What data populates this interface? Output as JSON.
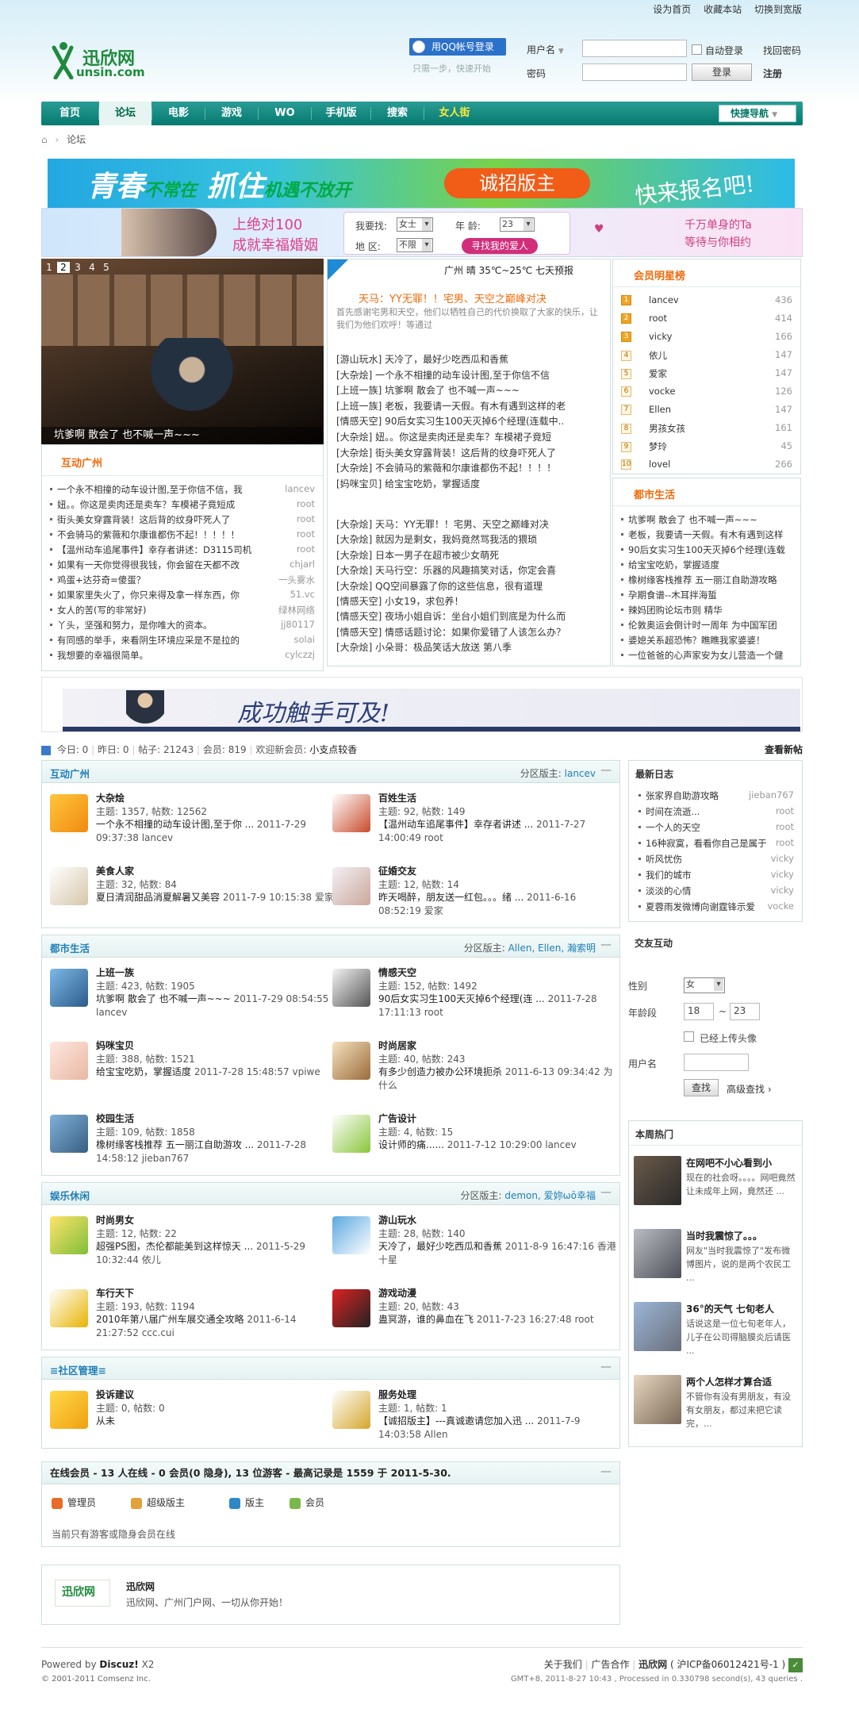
{
  "toplinks": [
    "设为首页",
    "收藏本站",
    "切换到宽版"
  ],
  "logo": {
    "cn": "迅欣网",
    "en": "unsin.com"
  },
  "login": {
    "qq_button": "用QQ帐号登录",
    "qq_sub": "只需一步，快速开始",
    "username_label": "用户名",
    "password_label": "密码",
    "autologin": "自动登录",
    "forgot": "找回密码",
    "login_btn": "登录",
    "register": "注册"
  },
  "nav": {
    "items": [
      "首页",
      "论坛",
      "电影",
      "游戏",
      "WO",
      "手机版",
      "搜索",
      "女人街"
    ],
    "quick": "快捷导航"
  },
  "breadcrumb": "论坛",
  "banner1": {
    "a": "青春",
    "b": "不常在",
    "c": "抓住",
    "d": "机遇不放开",
    "btn": "诚招版主",
    "tag": "快来报名吧!"
  },
  "banner2": {
    "l1": "上绝对100",
    "l2": "成就幸福婚姻",
    "find": "我要找:",
    "gender": "女士",
    "age_label": "年  龄:",
    "age": "23",
    "area": "地  区:",
    "area_val": "不限",
    "btn": "寻找我的爱人",
    "r1": "千万单身的Ta",
    "r2": "等待与你相约"
  },
  "slider": {
    "nums": [
      "1",
      "2",
      "3",
      "4",
      "5"
    ],
    "caption": "坑爹啊 散会了 也不喊一声~~~"
  },
  "weather": "广州  晴  35℃~25℃  七天预报",
  "headline": {
    "title": "天马：YY无罪！！宅男、天空之巅峰对决",
    "desc": "首先感谢宅男和天空，他们以牺牲自己的代价换取了大家的快乐，让我们为他们欢呼！等通过"
  },
  "news1": [
    "[游山玩水] 天冷了，最好少吃西瓜和香蕉",
    "[大杂烩] 一个永不相撞的动车设计图,至于你信不信",
    "[上班一族] 坑爹啊 散会了 也不喊一声~~~",
    "[上班一族] 老板，我要请一天假。有木有遇到这样的老",
    "[情感天空] 90后女实习生100天灭掉6个经理(连载中..",
    "[大杂烩] 妞。。你这是卖肉还是卖车？车模裙子竟短",
    "[大杂烩] 街头美女穿露背装！这后背的纹身吓死人了",
    "[大杂烩] 不会骑马的紫薇和尔康谁都伤不起！！！！",
    "[妈咪宝贝] 给宝宝吃奶，掌握适度"
  ],
  "news2": [
    "[大杂烩] 天马：YY无罪！！宅男、天空之巅峰对决",
    "[大杂烩] 就因为是剩女，我妈竟然骂我活的猥琐",
    "[大杂烩] 日本一男子在超市被少女萌死",
    "[大杂烩] 天马行空：乐器的风趣搞笑对话，你定会喜",
    "[大杂烩] QQ空间暴露了你的这些信息，很有道理",
    "[情感天空] 小女19，求包养！",
    "[情感天空] 夜场小姐自诉：坐台小姐们到底是为什么而",
    "[情感天空] 情感话题讨论：如果你爱错了人该怎么办？",
    "[大杂烩] 小朵哥：极品笑话大放送 第八季"
  ],
  "hudong": {
    "title": "互动广州",
    "items": [
      {
        "t": "一个永不相撞的动车设计图,至于你信不信，我",
        "a": "lancev"
      },
      {
        "t": "妞。。你这是卖肉还是卖车？车模裙子竟短成",
        "a": "root"
      },
      {
        "t": "街头美女穿露背装！这后背的纹身吓死人了",
        "a": "root"
      },
      {
        "t": "不会骑马的紫薇和尔康谁都伤不起！！！！！",
        "a": "root"
      },
      {
        "t": "【温州动车追尾事件】幸存者讲述：D3115司机",
        "a": "root"
      },
      {
        "t": "如果有一天你觉得很我钱，你会留在天都不改",
        "a": "chjarl"
      },
      {
        "t": "鸡蛋+达芬奇=傻蛋？",
        "a": "一头雾水"
      },
      {
        "t": "如果家里失火了，你只来得及拿一样东西，你",
        "a": "51.vc"
      },
      {
        "t": "女人的苦(写的非常好)",
        "a": "绿林网络"
      },
      {
        "t": "丫头，坚强和努力，是你唯大的资本。",
        "a": "jj80117"
      },
      {
        "t": "有同感的举手，来看阴生环境应采是不是拉的",
        "a": "solai"
      },
      {
        "t": "我想要的幸福很简单。",
        "a": "cylczzj"
      }
    ]
  },
  "rank": {
    "title": "会员明星榜",
    "items": [
      {
        "n": "lancev",
        "s": "436"
      },
      {
        "n": "root",
        "s": "414"
      },
      {
        "n": "vicky",
        "s": "166"
      },
      {
        "n": "依儿",
        "s": "147"
      },
      {
        "n": "爱家",
        "s": "147"
      },
      {
        "n": "vocke",
        "s": "126"
      },
      {
        "n": "Ellen",
        "s": "147"
      },
      {
        "n": "男孩女孩",
        "s": "161"
      },
      {
        "n": "梦玲",
        "s": "45"
      },
      {
        "n": "lovel",
        "s": "266"
      }
    ]
  },
  "dushi": {
    "title": "都市生活",
    "items": [
      "坑爹啊 散会了 也不喊一声~~~",
      "老板，我要请一天假。有木有遇到这样",
      "90后女实习生100天灭掉6个经理(连载",
      "给宝宝吃奶，掌握适度",
      "橡树缘客栈推荐 五一丽江自助游攻略",
      "孕期食谱--木耳拌海蜇",
      "辣妈团购论坛市则 精华",
      "伦敦奥运会倒计时一周年 为中国军团",
      "婆媳关系超恐怖？瞧瞧我家婆婆！",
      "一位爸爸的心声家安为女儿营造一个健"
    ]
  },
  "banner3": "成功触手可及!",
  "stats": {
    "today": "今日: 0",
    "yesterday": "昨日: 0",
    "posts": "帖子: 21243",
    "members": "会员: 819",
    "welcome": "欢迎新会员:",
    "newmember": "小支点较香",
    "viewnew": "查看新帖"
  },
  "sections": [
    {
      "title": "互动广州",
      "mods_label": "分区版主:",
      "mods": "lancev",
      "forums": [
        {
          "name": "大杂烩",
          "stat": "主题: 1357, 帖数: 12562",
          "last": "一个永不相撞的动车设计图,至于你 ...",
          "time": "2011-7-29 09:37:38 lancev"
        },
        {
          "name": "百姓生活",
          "stat": "主题: 92, 帖数: 149",
          "last": "【温州动车追尾事件】幸存者讲述 ...",
          "time": "2011-7-27 14:00:49 root"
        },
        {
          "name": "美食人家",
          "stat": "主题: 32, 帖数: 84",
          "last": "夏日清润甜品消夏解暑又美容",
          "time": "2011-7-9 10:15:38 爱家"
        },
        {
          "name": "征婚交友",
          "stat": "主题: 12, 帖数: 14",
          "last": "昨天喝醉，朋友送一红包。。。绪 ...",
          "time": "2011-6-16 08:52:19 爱家"
        }
      ]
    },
    {
      "title": "都市生活",
      "mods_label": "分区版主:",
      "mods": "Allen, Ellen, 瀚索明",
      "forums": [
        {
          "name": "上班一族",
          "stat": "主题: 423, 帖数: 1905",
          "last": "坑爹啊 散会了 也不喊一声~~~",
          "time": "2011-7-29 08:54:55 lancev"
        },
        {
          "name": "情感天空",
          "stat": "主题: 152, 帖数: 1492",
          "last": "90后女实习生100天灭掉6个经理(连 ...",
          "time": "2011-7-28 17:11:13 root"
        },
        {
          "name": "妈咪宝贝",
          "stat": "主题: 388, 帖数: 1521",
          "last": "给宝宝吃奶，掌握适度",
          "time": "2011-7-28 15:48:57 vpiwe"
        },
        {
          "name": "时尚居家",
          "stat": "主题: 40, 帖数: 243",
          "last": "有多少创造力被办公环境扼杀",
          "time": "2011-6-13 09:34:42 为什么"
        },
        {
          "name": "校园生活",
          "stat": "主题: 109, 帖数: 1858",
          "last": "橡树缘客栈推荐 五一丽江自助游攻 ...",
          "time": "2011-7-28 14:58:12 jieban767"
        },
        {
          "name": "广告设计",
          "stat": "主题: 4, 帖数: 15",
          "last": "设计师的痛......",
          "time": "2011-7-12 10:29:00 lancev"
        }
      ]
    },
    {
      "title": "娱乐休闲",
      "mods_label": "分区版主:",
      "mods": "demon, 爱妳ωō幸福",
      "forums": [
        {
          "name": "时尚男女",
          "stat": "主题: 12, 帖数: 22",
          "last": "超强PS图，杰伦都能美到这样惊天 ...",
          "time": "2011-5-29 10:32:44 依儿"
        },
        {
          "name": "游山玩水",
          "stat": "主题: 28, 帖数: 140",
          "last": "天冷了，最好少吃西瓜和香蕉",
          "time": "2011-8-9 16:47:16 香港十星"
        },
        {
          "name": "车行天下",
          "stat": "主题: 193, 帖数: 1194",
          "last": "2010年第八届广州车展交通全攻略",
          "time": "2011-6-14 21:27:52 ccc.cui"
        },
        {
          "name": "游戏动漫",
          "stat": "主题: 20, 帖数: 43",
          "last": "蛊冥游，谁的鼻血在飞",
          "time": "2011-7-23 16:27:48 root"
        }
      ]
    },
    {
      "title": "≡社区管理≡",
      "mods_label": "",
      "mods": "",
      "forums": [
        {
          "name": "投诉建议",
          "stat": "主题: 0, 帖数: 0",
          "last": "从未",
          "time": ""
        },
        {
          "name": "服务处理",
          "stat": "主题: 1, 帖数: 1",
          "last": "【诚招版主】---真诚邀请您加入迅 ...",
          "time": "2011-7-9 14:03:58 Allen"
        }
      ]
    }
  ],
  "blog": {
    "title": "最新日志",
    "items": [
      {
        "t": "张家界自助游攻略",
        "a": "jieban767"
      },
      {
        "t": "时间在流逝...",
        "a": "root"
      },
      {
        "t": "一个人的天空",
        "a": "root"
      },
      {
        "t": "16种寂寞，看看你自己是属于",
        "a": "root"
      },
      {
        "t": "听风忧伤",
        "a": "vicky"
      },
      {
        "t": "我们的城市",
        "a": "vicky"
      },
      {
        "t": "淡淡的心情",
        "a": "vicky"
      },
      {
        "t": "夏蓉雨发微博向谢霆锋示爱",
        "a": "vocke"
      }
    ]
  },
  "dating": {
    "title": "交友互动",
    "gender_label": "性别",
    "gender": "女",
    "age_label": "年龄段",
    "age_from": "18",
    "age_to": "23",
    "photo": "已经上传头像",
    "user_label": "用户名",
    "search": "查找",
    "adv": "高级查找 ›"
  },
  "hot": {
    "title": "本周热门",
    "items": [
      {
        "t": "在网吧不小心看到小",
        "d": "现在的社会呀。。。。网吧竟然让未成年上网，竟然还 ..."
      },
      {
        "t": "当时我震惊了。。。",
        "d": "网友\"当时我震惊了\"发布微博图片，说的是两个农民工 ..."
      },
      {
        "t": "36°的天气 七旬老人",
        "d": "话说这是一位七旬老年人，儿子在公司得脑膜炎后请医 ..."
      },
      {
        "t": "两个人怎样才算合适",
        "d": "不管你有没有男朋友，有没有女朋友，都过来把它读完，..."
      }
    ]
  },
  "online": {
    "title": "在线会员 - 13 人在线 - 0 会员(0 隐身), 13 位游客 - 最高记录是 1559 于 2011-5-30.",
    "legend": [
      "管理员",
      "超级版主",
      "版主",
      "会员"
    ],
    "note": "当前只有游客或隐身会员在线"
  },
  "friend": {
    "name": "迅欣网",
    "desc": "迅欣网、广州门户网、一切从你开始！"
  },
  "footer": {
    "powered": "Powered by",
    "discuz": "Discuz!",
    "ver": "X2",
    "copy": "© 2001-2011 Comsenz Inc.",
    "links": [
      "关于我们",
      "广告合作",
      "迅欣网",
      "( 沪ICP备06012421号-1 )"
    ],
    "gmt": "GMT+8, 2011-8-27 10:43 , Processed in 0.330798 second(s), 43 queries ."
  }
}
